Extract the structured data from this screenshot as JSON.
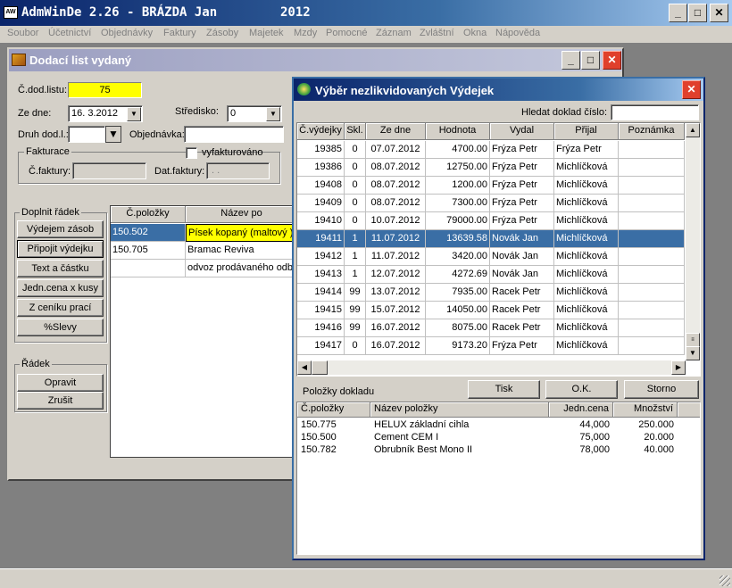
{
  "app": {
    "title": "AdmWinDe 2.26 - BRÁZDA Jan",
    "year": "2012"
  },
  "menu": [
    "Soubor",
    "Účetnictví",
    "Objednávky",
    "Faktury",
    "Zásoby",
    "Majetek",
    "Mzdy",
    "Pomocné",
    "Záznam",
    "Zvláštní",
    "Okna",
    "Nápověda"
  ],
  "dodaci": {
    "title": "Dodací list vydaný",
    "cislo_label": "Č.dod.listu:",
    "cislo_value": "75",
    "ze_dne_label": "Ze dne:",
    "ze_dne_value": "16. 3.2012",
    "stredisko_label": "Středisko:",
    "stredisko_value": "0",
    "druh_label": "Druh dod.l.:",
    "druh_value": "",
    "objednavka_label": "Objednávka:",
    "objednavka_value": "",
    "fakturace_label": "Fakturace",
    "vyfakturovano_label": "vyfakturováno",
    "cfaktury_label": "Č.faktury:",
    "cfaktury_value": "",
    "datfaktury_label": "Dat.faktury:",
    "datfaktury_value": ". .",
    "doplnit_label": "Doplnit řádek",
    "buttons": [
      "Výdejem zásob",
      "Připojit výdejku",
      "Text a částku",
      "Jedn.cena x kusy",
      "Z ceníku prací",
      "%Slevy"
    ],
    "radek_label": "Řádek",
    "opravit": "Opravit",
    "zrusit": "Zrušit",
    "table_headers": [
      "Č.položky",
      "Název po"
    ],
    "rows": [
      {
        "code": "150.502",
        "name": "Písek kopaný (maltový )"
      },
      {
        "code": "150.705",
        "name": "Bramac Reviva"
      },
      {
        "code": "",
        "name": "odvoz prodávaného odb"
      }
    ]
  },
  "vyber": {
    "title": "Výběr nezlikvidovaných Výdejek",
    "hledat_label": "Hledat doklad číslo:",
    "hledat_value": "",
    "headers": [
      "Č.výdejky",
      "Skl.",
      "Ze dne",
      "Hodnota",
      "Vydal",
      "Přijal",
      "Poznámka"
    ],
    "rows": [
      [
        "19385",
        "0",
        "07.07.2012",
        "4700.00",
        "Frýza Petr",
        "Frýza Petr",
        ""
      ],
      [
        "19386",
        "0",
        "08.07.2012",
        "12750.00",
        "Frýza Petr",
        "Michlíčková",
        ""
      ],
      [
        "19408",
        "0",
        "08.07.2012",
        "1200.00",
        "Frýza Petr",
        "Michlíčková",
        ""
      ],
      [
        "19409",
        "0",
        "08.07.2012",
        "7300.00",
        "Frýza Petr",
        "Michlíčková",
        ""
      ],
      [
        "19410",
        "0",
        "10.07.2012",
        "79000.00",
        "Frýza Petr",
        "Michlíčková",
        ""
      ],
      [
        "19411",
        "1",
        "11.07.2012",
        "13639.58",
        "Novák Jan",
        "Michlíčková",
        ""
      ],
      [
        "19412",
        "1",
        "11.07.2012",
        "3420.00",
        "Novák Jan",
        "Michlíčková",
        ""
      ],
      [
        "19413",
        "1",
        "12.07.2012",
        "4272.69",
        "Novák Jan",
        "Michlíčková",
        ""
      ],
      [
        "19414",
        "99",
        "13.07.2012",
        "7935.00",
        "Racek Petr",
        "Michlíčková",
        ""
      ],
      [
        "19415",
        "99",
        "15.07.2012",
        "14050.00",
        "Racek Petr",
        "Michlíčková",
        ""
      ],
      [
        "19416",
        "99",
        "16.07.2012",
        "8075.00",
        "Racek Petr",
        "Michlíčková",
        ""
      ],
      [
        "19417",
        "0",
        "16.07.2012",
        "9173.20",
        "Frýza Petr",
        "Michlíčková",
        ""
      ]
    ],
    "selected_row": "19411",
    "polozky_label": "Položky dokladu",
    "tisk": "Tisk",
    "ok": "O.K.",
    "storno": "Storno",
    "item_headers": [
      "Č.položky",
      "Název položky",
      "Jedn.cena",
      "Množství"
    ],
    "items": [
      [
        "150.775",
        "HELUX základní cihla",
        "44,000",
        "250.000"
      ],
      [
        "150.500",
        "Cement CEM I",
        "75,000",
        "20.000"
      ],
      [
        "150.782",
        "Obrubník Best Mono II",
        "78,000",
        "40.000"
      ]
    ]
  },
  "colors": {
    "title_active": "#0a246a",
    "title_inactive": "#9b9ec0",
    "selection": "#3a6ea5",
    "highlight_field": "#ffff00"
  }
}
